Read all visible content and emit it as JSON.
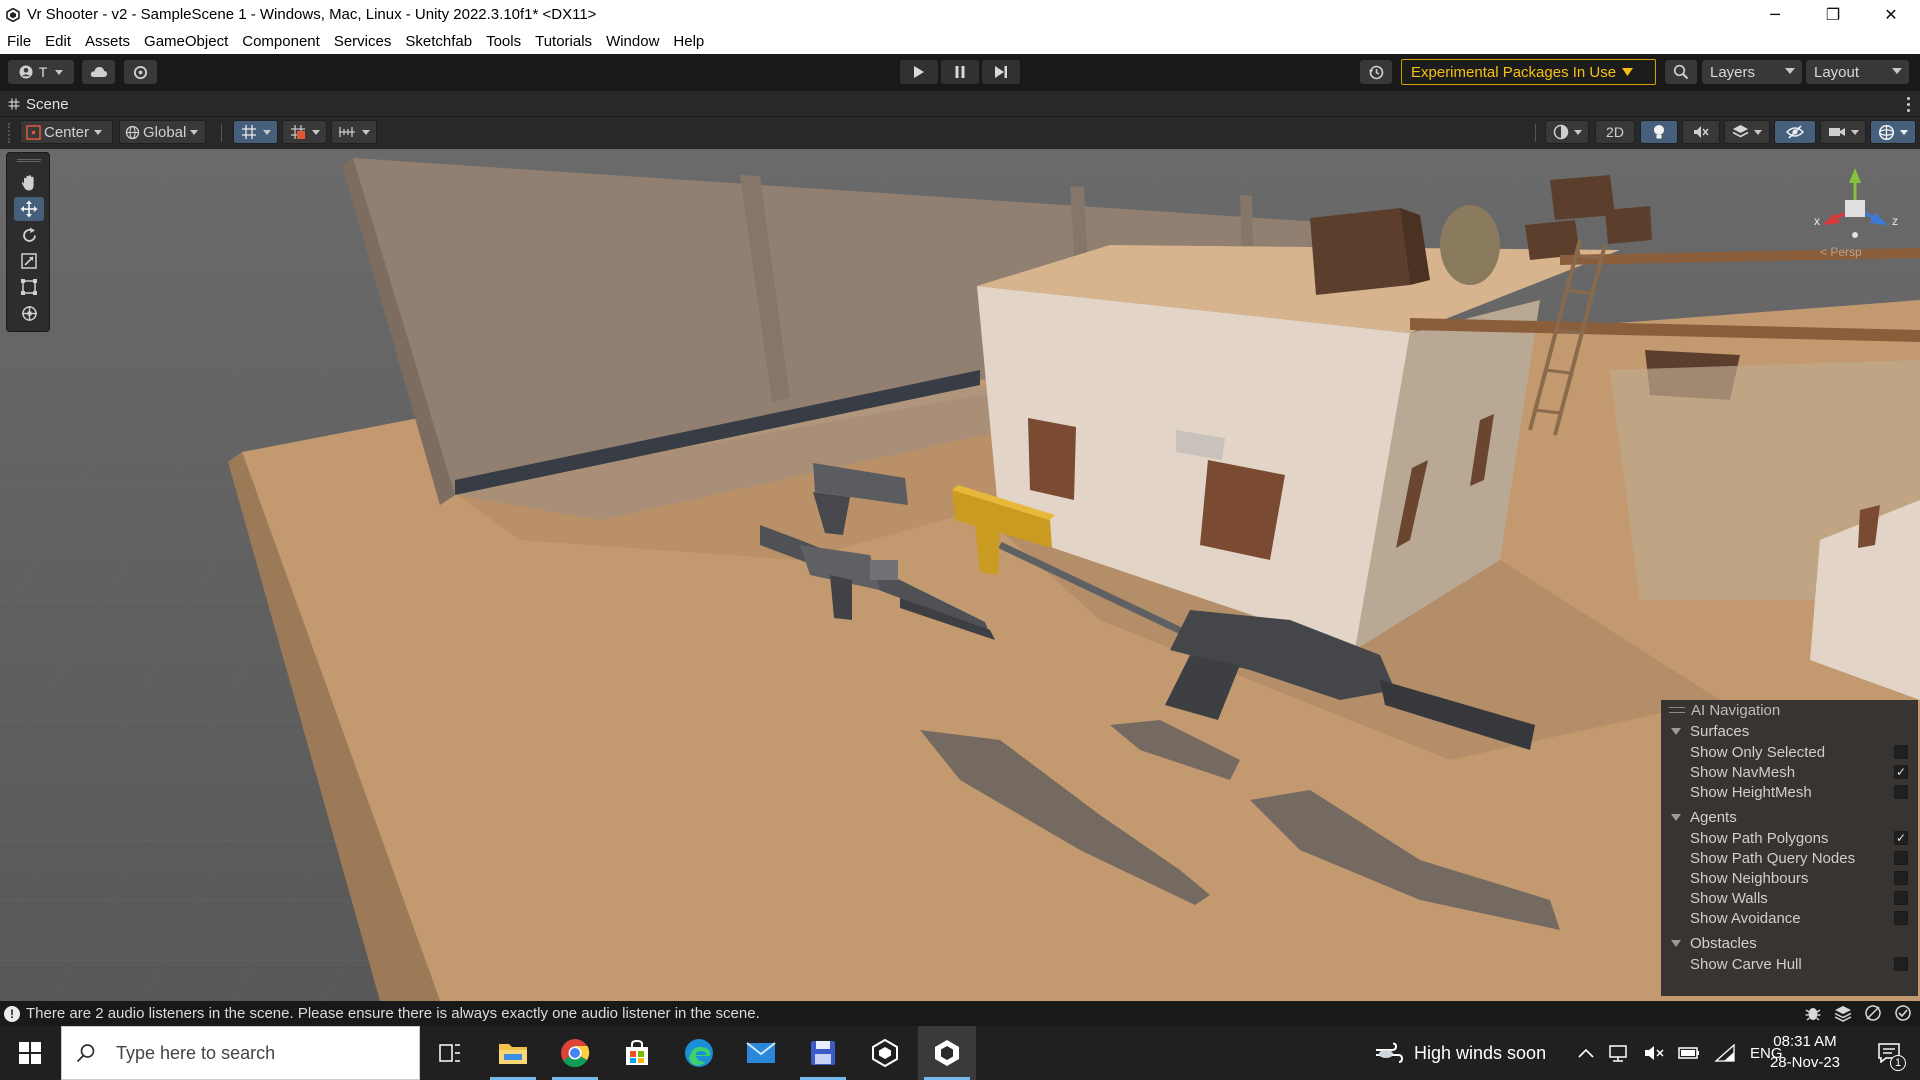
{
  "window": {
    "title": "Vr Shooter - v2 - SampleScene 1 - Windows, Mac, Linux - Unity 2022.3.10f1* <DX11>",
    "minimize": "─",
    "maximize": "❐",
    "close": "✕"
  },
  "menu": [
    "File",
    "Edit",
    "Assets",
    "GameObject",
    "Component",
    "Services",
    "Sketchfab",
    "Tools",
    "Tutorials",
    "Window",
    "Help"
  ],
  "toolbar": {
    "account_label": "T",
    "experimental_label": "Experimental Packages In Use",
    "layers_label": "Layers",
    "layout_label": "Layout"
  },
  "scene_tab": {
    "label": "Scene"
  },
  "scene_toolbar": {
    "pivot_label": "Center",
    "space_label": "Global",
    "mode_2d_label": "2D"
  },
  "gizmo": {
    "x_label": "x",
    "z_label": "z",
    "persp_label": "< Persp"
  },
  "ai_navigation": {
    "title": "AI Navigation",
    "groups": [
      {
        "label": "Surfaces",
        "options": [
          {
            "label": "Show Only Selected",
            "checked": false
          },
          {
            "label": "Show NavMesh",
            "checked": true
          },
          {
            "label": "Show HeightMesh",
            "checked": false
          }
        ]
      },
      {
        "label": "Agents",
        "options": [
          {
            "label": "Show Path Polygons",
            "checked": true
          },
          {
            "label": "Show Path Query Nodes",
            "checked": false
          },
          {
            "label": "Show Neighbours",
            "checked": false
          },
          {
            "label": "Show Walls",
            "checked": false
          },
          {
            "label": "Show Avoidance",
            "checked": false
          }
        ]
      },
      {
        "label": "Obstacles",
        "options": [
          {
            "label": "Show Carve Hull",
            "checked": false
          }
        ]
      }
    ]
  },
  "status": {
    "message": "There are 2 audio listeners in the scene. Please ensure there is always exactly one audio listener in the scene."
  },
  "taskbar": {
    "search_placeholder": "Type here to search",
    "weather": "High winds soon",
    "language": "ENG",
    "time": "08:31 AM",
    "date": "28-Nov-23",
    "notification_count": "1"
  },
  "colors": {
    "accent_experimental": "#f5c014",
    "selected_tool": "#46607c",
    "ground": "#c39a6f"
  }
}
